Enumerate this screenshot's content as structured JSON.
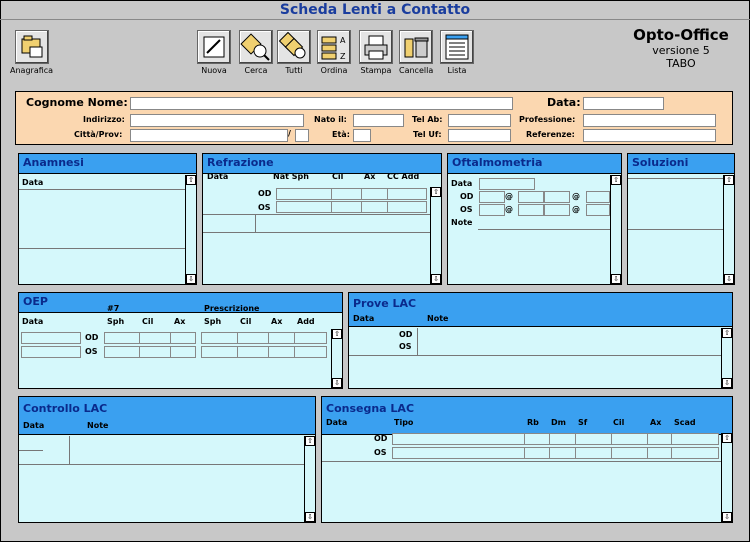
{
  "window_title": "Scheda Lenti a Contatto",
  "brand": {
    "name": "Opto-Office",
    "version": "versione 5",
    "user": "TABO"
  },
  "toolbar": {
    "anagrafica": "Anagrafica",
    "nuova": "Nuova",
    "cerca": "Cerca",
    "tutti": "Tutti",
    "ordina": "Ordina",
    "stampa": "Stampa",
    "cancella": "Cancella",
    "lista": "Lista"
  },
  "form": {
    "cognome_nome": "Cognome Nome:",
    "data": "Data:",
    "indirizzo": "Indirizzo:",
    "nato_il": "Nato il:",
    "tel_ab": "Tel Ab:",
    "professione": "Professione:",
    "citta_prov": "Città/Prov:",
    "slash": "/",
    "eta": "Età:",
    "tel_uf": "Tel Uf:",
    "referenze": "Referenze:"
  },
  "anamnesi": {
    "title": "Anamnesi",
    "col_data": "Data"
  },
  "refrazione": {
    "title": "Refrazione",
    "cols": [
      "Data",
      "Nat Sph",
      "Cil",
      "Ax",
      "CC Add"
    ],
    "od": "OD",
    "os": "OS"
  },
  "oftalmometria": {
    "title": "Oftalmometria",
    "data": "Data",
    "od": "OD",
    "os": "OS",
    "note": "Note",
    "at": "@"
  },
  "soluzioni": {
    "title": "Soluzioni"
  },
  "oep": {
    "title": "OEP",
    "num": "#7",
    "prescrizione": "Prescrizione",
    "cols": [
      "Data",
      "Sph",
      "Cil",
      "Ax",
      "Sph",
      "Cil",
      "Ax",
      "Add"
    ],
    "od": "OD",
    "os": "OS"
  },
  "prove_lac": {
    "title": "Prove LAC",
    "col_data": "Data",
    "col_note": "Note",
    "od": "OD",
    "os": "OS"
  },
  "controllo_lac": {
    "title": "Controllo LAC",
    "col_data": "Data",
    "col_note": "Note"
  },
  "consegna_lac": {
    "title": "Consegna LAC",
    "cols": [
      "Data",
      "Tipo",
      "Rb",
      "Dm",
      "Sf",
      "Cil",
      "Ax",
      "Scad"
    ],
    "od": "OD",
    "os": "OS"
  },
  "colors": {
    "panel_bg": "#d5f8fb",
    "header_bg": "#3aa0f0",
    "form_bg": "#fbd7b0",
    "title": "#1a3d9e"
  }
}
